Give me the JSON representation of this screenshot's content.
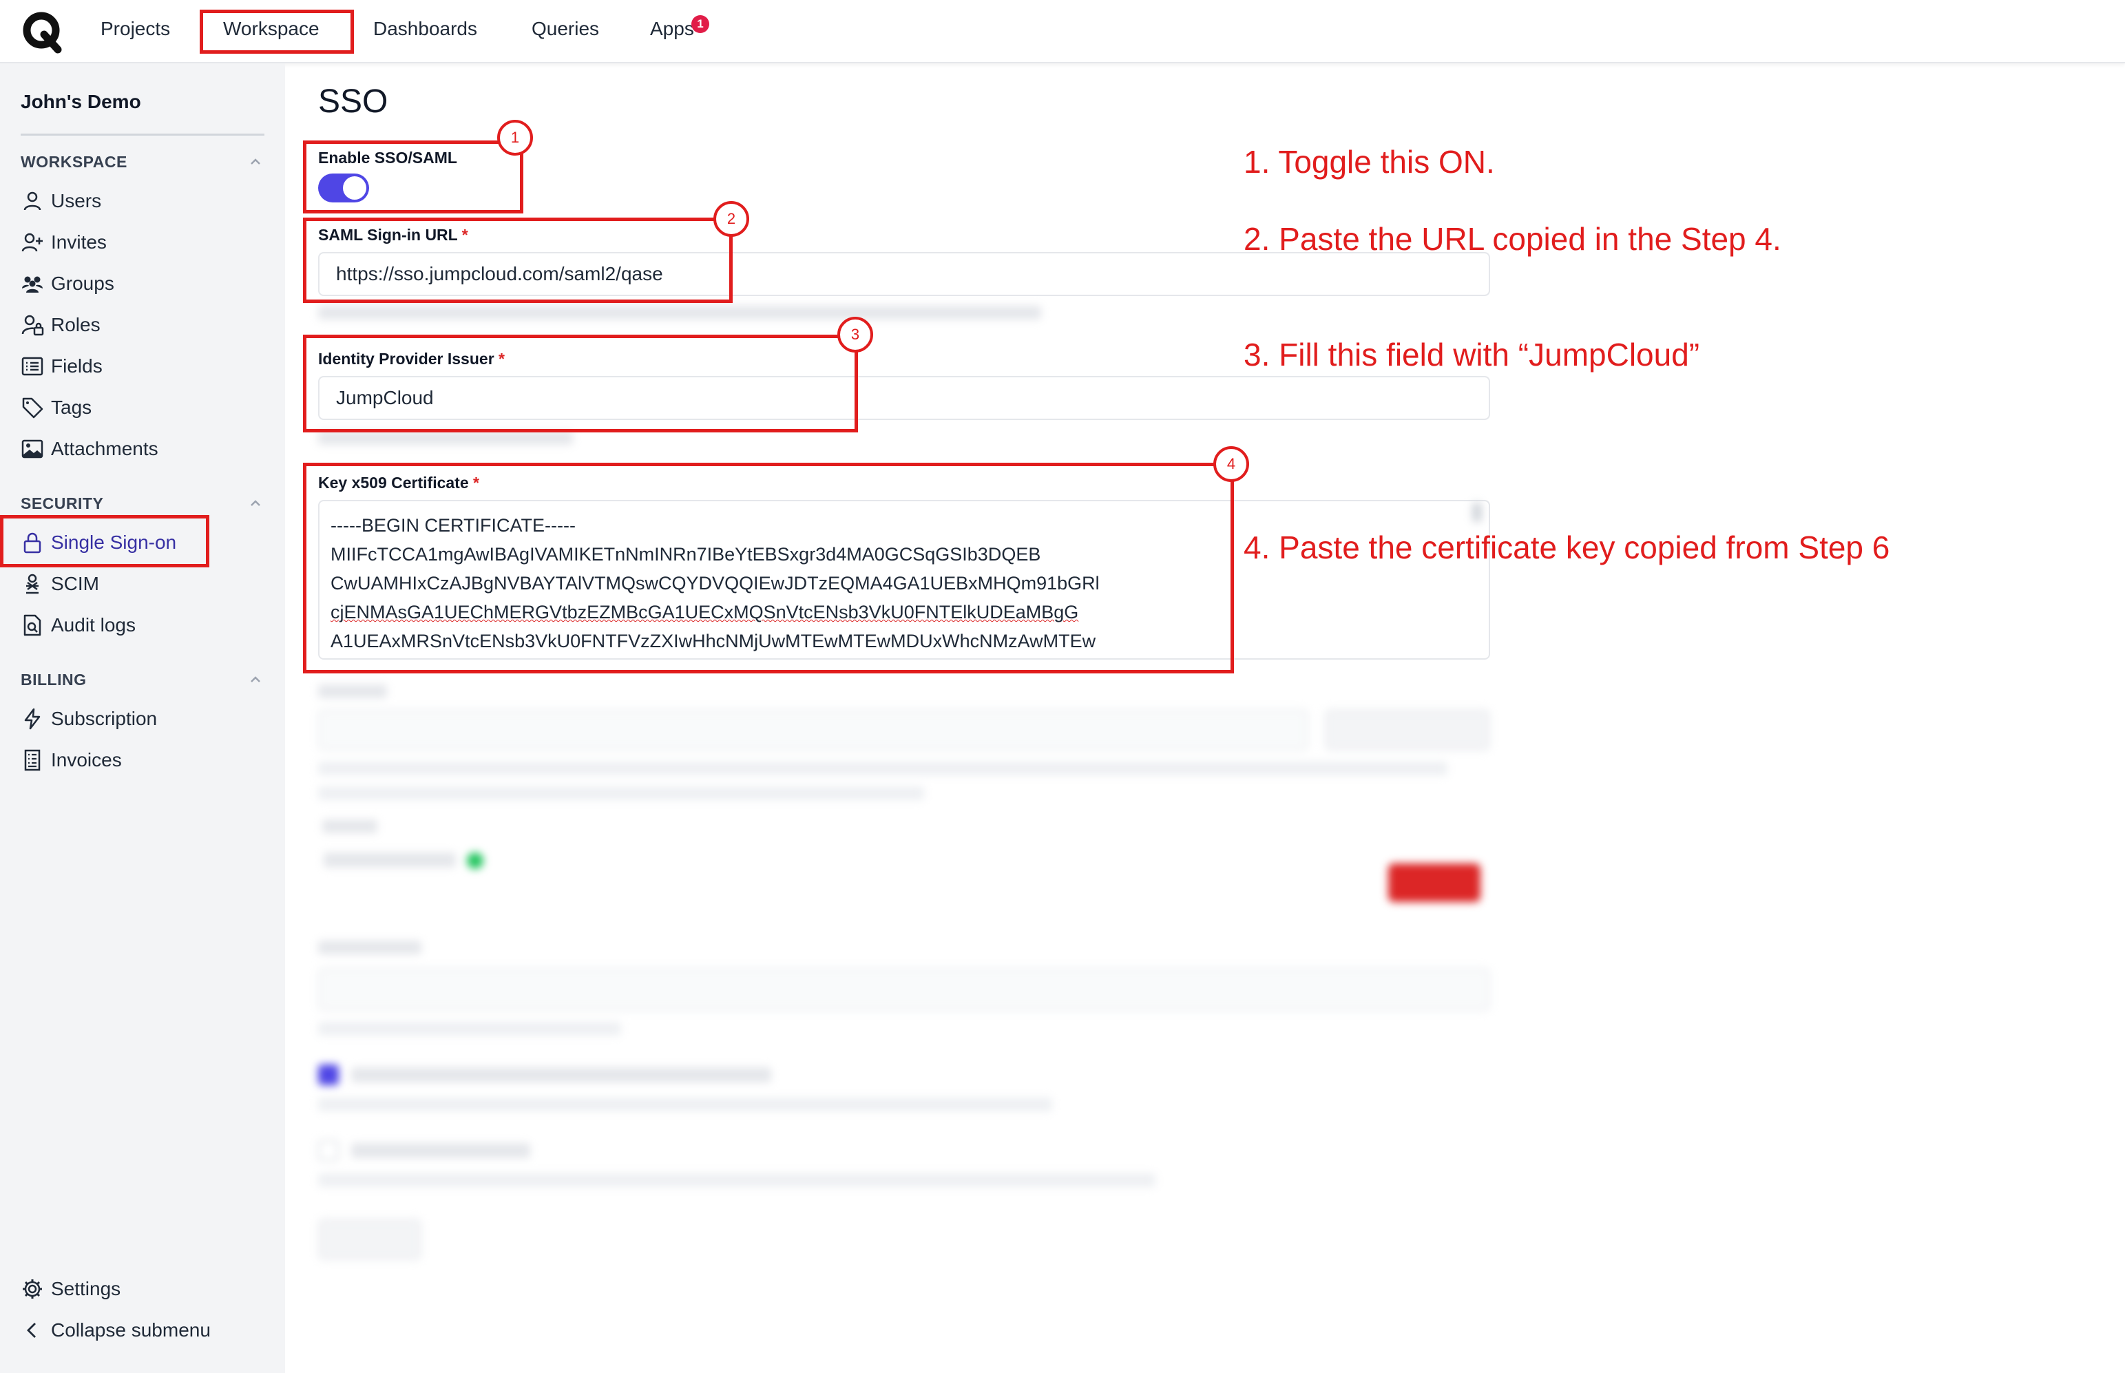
{
  "nav": {
    "items": [
      "Projects",
      "Workspace",
      "Dashboards",
      "Queries",
      "Apps"
    ],
    "apps_badge": "1"
  },
  "sidebar": {
    "workspace_name": "John's Demo",
    "sections": {
      "workspace": {
        "title": "WORKSPACE",
        "items": [
          {
            "label": "Users",
            "icon": "user-icon"
          },
          {
            "label": "Invites",
            "icon": "user-plus-icon"
          },
          {
            "label": "Groups",
            "icon": "groups-icon"
          },
          {
            "label": "Roles",
            "icon": "user-lock-icon"
          },
          {
            "label": "Fields",
            "icon": "list-icon"
          },
          {
            "label": "Tags",
            "icon": "tag-icon"
          },
          {
            "label": "Attachments",
            "icon": "image-icon"
          }
        ]
      },
      "security": {
        "title": "SECURITY",
        "items": [
          {
            "label": "Single Sign-on",
            "icon": "lock-icon",
            "active": true
          },
          {
            "label": "SCIM",
            "icon": "scim-icon"
          },
          {
            "label": "Audit logs",
            "icon": "audit-log-icon"
          }
        ]
      },
      "billing": {
        "title": "BILLING",
        "items": [
          {
            "label": "Subscription",
            "icon": "bolt-icon"
          },
          {
            "label": "Invoices",
            "icon": "receipt-icon"
          }
        ]
      }
    },
    "footer": {
      "settings": "Settings",
      "collapse": "Collapse submenu"
    }
  },
  "main": {
    "title": "SSO",
    "enable_label": "Enable SSO/SAML",
    "enable_value": true,
    "sign_in_url": {
      "label": "SAML Sign-in URL",
      "required_mark": "*",
      "value": "https://sso.jumpcloud.com/saml2/qase"
    },
    "issuer": {
      "label": "Identity Provider Issuer",
      "required_mark": "*",
      "value": "JumpCloud"
    },
    "certificate": {
      "label": "Key x509 Certificate",
      "required_mark": "*",
      "lines": [
        "-----BEGIN CERTIFICATE-----",
        "MIIFcTCCA1mgAwIBAgIVAMIKETnNmINRn7IBeYtEBSxgr3d4MA0GCSqGSIb3DQEB",
        "CwUAMHIxCzAJBgNVBAYTAlVTMQswCQYDVQQIEwJDTzEQMA4GA1UEBxMHQm91bGRl",
        "cjENMAsGA1UEChMERGVtbzEZMBcGA1UECxMQSnVtcENsb3VkU0FNTElkUDEaMBgG",
        "A1UEAxMRSnVtcENsb3VkU0FNTFVzZXIwHhcNMjUwMTEwMTEwMDUxWhcNMzAwMTEw"
      ]
    }
  },
  "annotations": {
    "markers": [
      "1",
      "2",
      "3",
      "4"
    ],
    "notes": [
      "1. Toggle this ON.",
      "2. Paste the URL copied in the Step 4.",
      "3. Fill this field with “JumpCloud”",
      "4. Paste the certificate key copied from Step 6"
    ],
    "color": "#e11d1d"
  },
  "colors": {
    "accent": "#4f46e5",
    "danger": "#dc2626",
    "sidebar_bg": "#f3f4f6"
  }
}
